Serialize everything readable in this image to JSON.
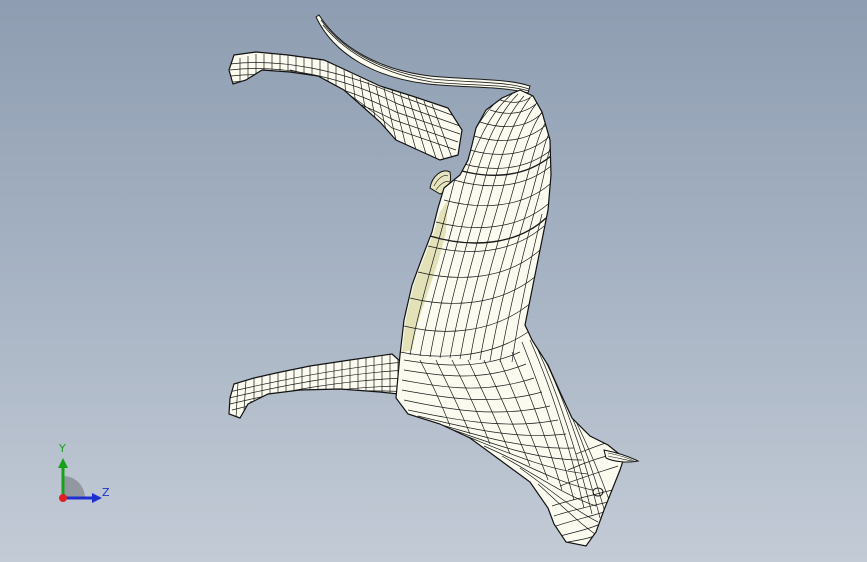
{
  "viewport": {
    "background_top": "#8e9db1",
    "background_bottom": "#c3cbd6"
  },
  "model": {
    "surface_color": "#fbfbf0",
    "shaded_color": "#e3e1b8",
    "mesh_color": "#1a1a1a"
  },
  "triad": {
    "y_label": "Y",
    "z_label": "Z",
    "y_color": "#18a018",
    "z_color": "#2030d0",
    "origin_color": "#e02020"
  }
}
